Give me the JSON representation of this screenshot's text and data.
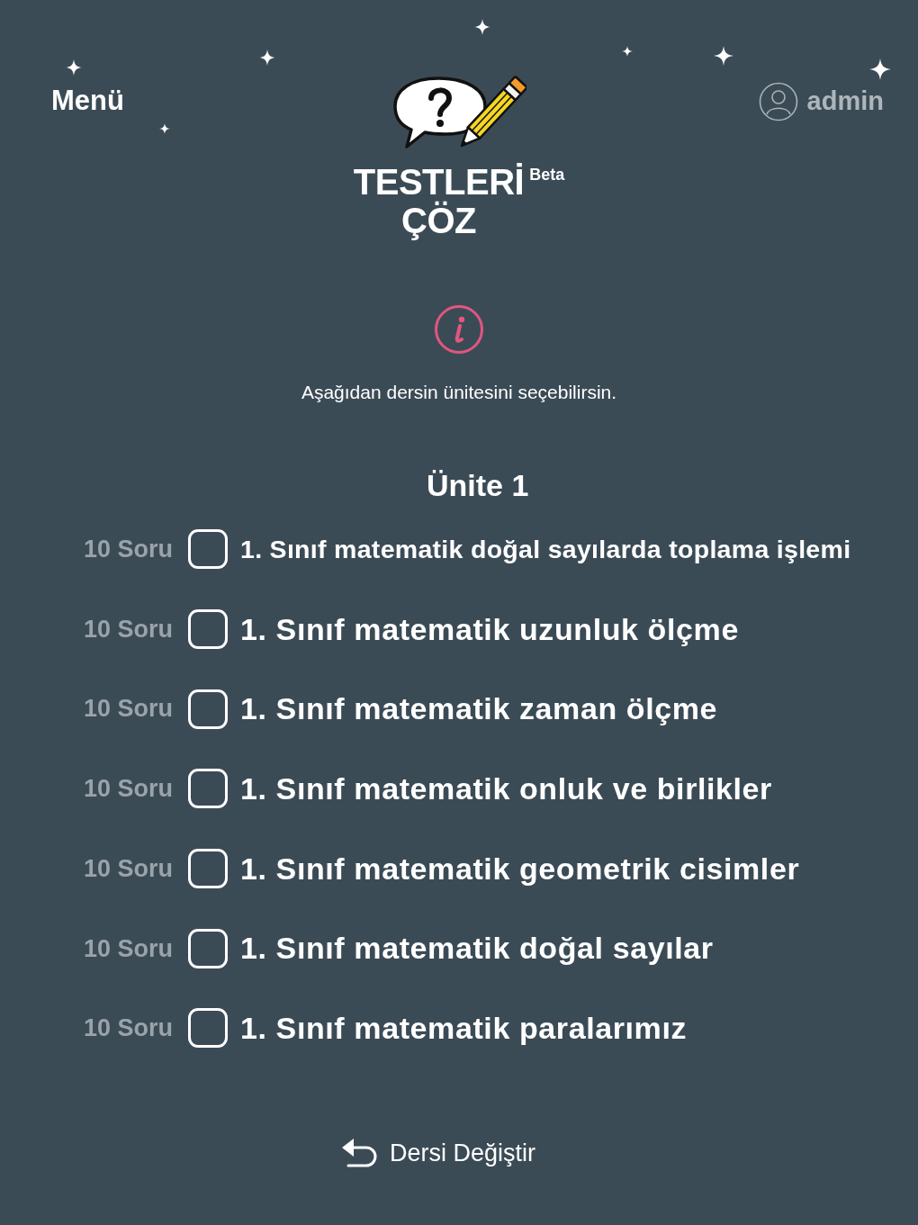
{
  "header": {
    "menu": "Menü",
    "user": {
      "name": "admin"
    }
  },
  "logo": {
    "title_lines": [
      "TESTLERİ",
      "ÇÖZ"
    ],
    "badge": "Beta"
  },
  "info": {
    "message": "Aşağıdan dersin ünitesini seçebilirsin."
  },
  "unit": {
    "title": "Ünite 1",
    "topics": [
      {
        "count": "10 Soru",
        "label": "1. Sınıf matematik doğal sayılarda toplama işlemi",
        "checked": false
      },
      {
        "count": "10 Soru",
        "label": "1. Sınıf matematik uzunluk ölçme",
        "checked": false
      },
      {
        "count": "10 Soru",
        "label": "1. Sınıf matematik zaman ölçme",
        "checked": false
      },
      {
        "count": "10 Soru",
        "label": "1. Sınıf matematik onluk ve birlikler",
        "checked": false
      },
      {
        "count": "10 Soru",
        "label": "1. Sınıf matematik geometrik cisimler",
        "checked": false
      },
      {
        "count": "10 Soru",
        "label": "1. Sınıf matematik doğal sayılar",
        "checked": false
      },
      {
        "count": "10 Soru",
        "label": "1. Sınıf matematik paralarımız",
        "checked": false
      }
    ]
  },
  "footer": {
    "change_course": "Dersi Değiştir"
  }
}
